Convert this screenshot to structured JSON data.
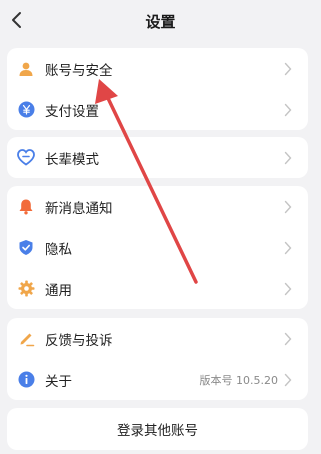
{
  "nav": {
    "title": "设置",
    "back_icon": "back-chevron-icon"
  },
  "groups": [
    {
      "items": [
        {
          "label": "账号与安全",
          "icon": "user-icon",
          "color": "#f0a64a"
        },
        {
          "label": "支付设置",
          "icon": "yuan-icon",
          "color": "#4a7fe8"
        }
      ]
    },
    {
      "items": [
        {
          "label": "长辈模式",
          "icon": "heart-shield-icon",
          "color": "#4a7fe8"
        }
      ]
    },
    {
      "items": [
        {
          "label": "新消息通知",
          "icon": "bell-icon",
          "color": "#f26b3a"
        },
        {
          "label": "隐私",
          "icon": "shield-check-icon",
          "color": "#4a7fe8"
        },
        {
          "label": "通用",
          "icon": "gear-icon",
          "color": "#f0a64a"
        }
      ]
    },
    {
      "items": [
        {
          "label": "反馈与投诉",
          "icon": "pencil-icon",
          "color": "#f0a64a"
        },
        {
          "label": "关于",
          "icon": "info-icon",
          "color": "#4a7fe8",
          "value": "版本号 10.5.20"
        }
      ]
    }
  ],
  "bottom_button": {
    "label": "登录其他账号"
  },
  "annotation": {
    "color": "#e04646"
  }
}
